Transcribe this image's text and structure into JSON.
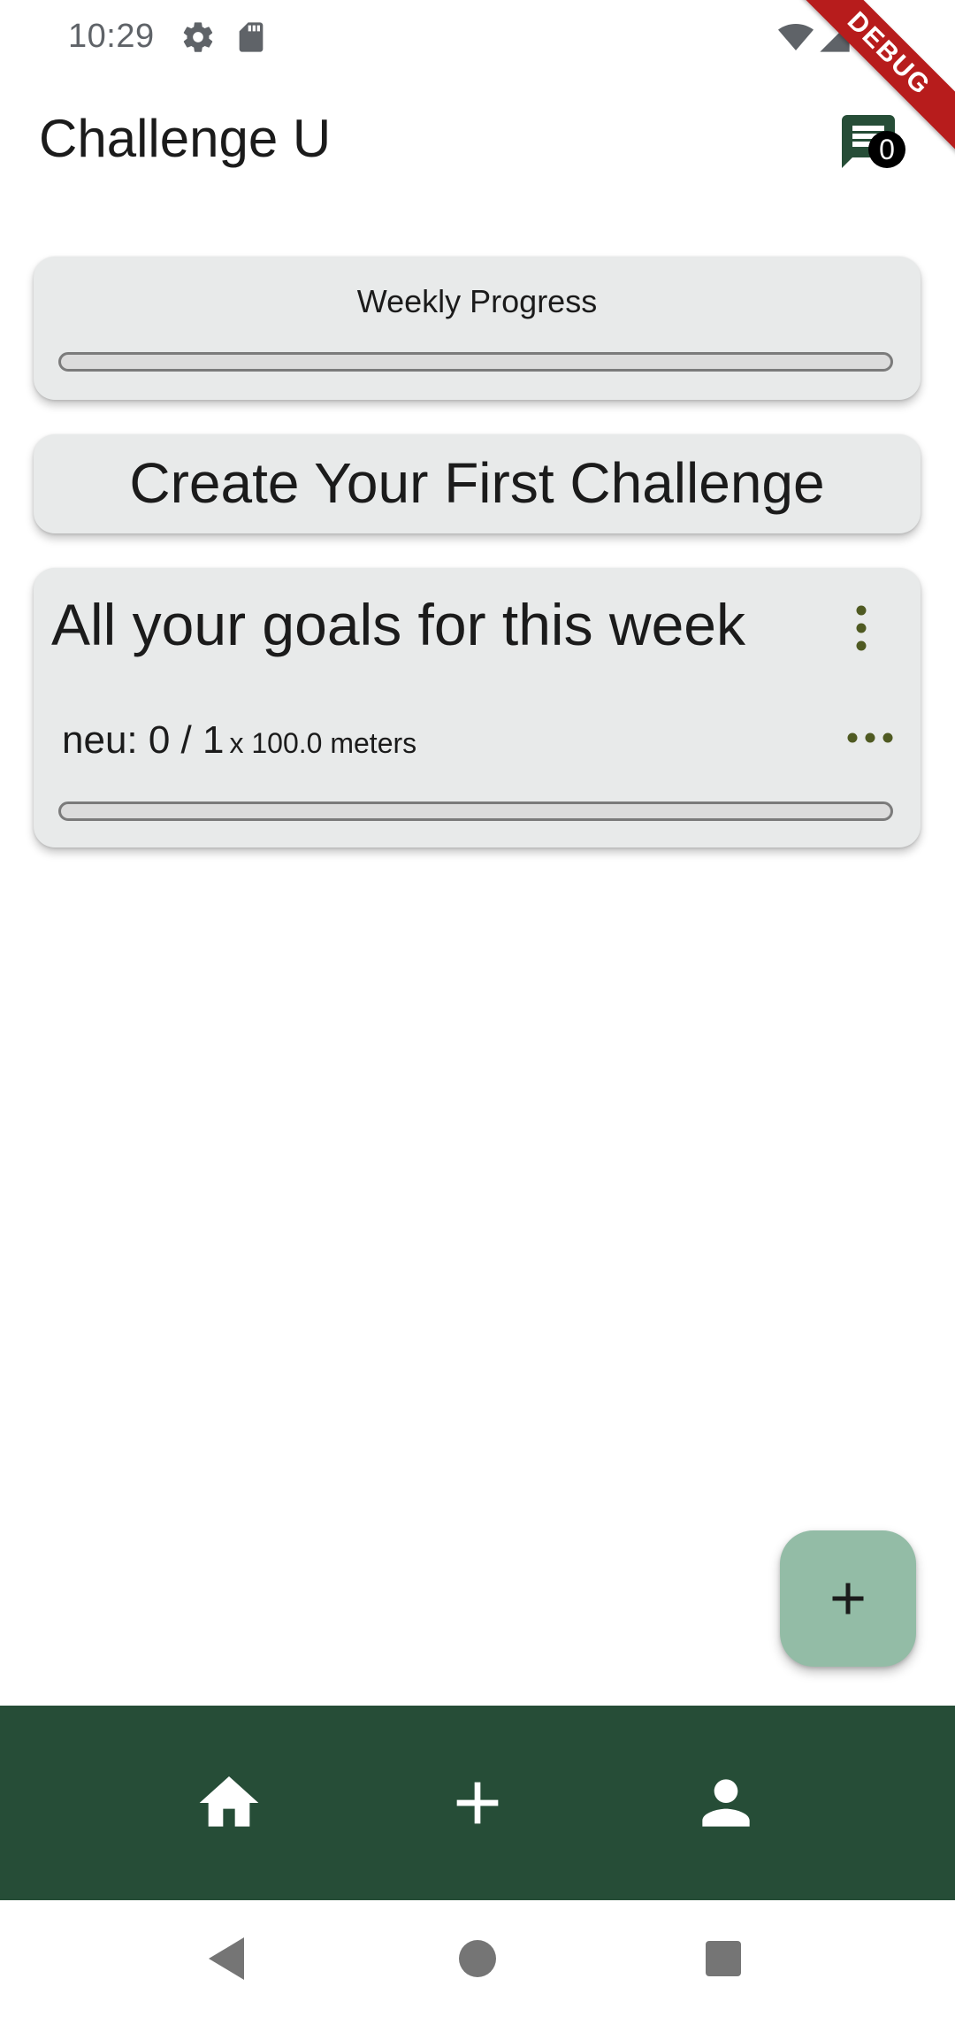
{
  "status_bar": {
    "time": "10:29",
    "icons": [
      "settings-icon",
      "sd-card-icon",
      "wifi-icon",
      "cell-signal-icon",
      "battery-icon"
    ]
  },
  "debug_banner": "DEBUG",
  "app_bar": {
    "title": "Challenge U",
    "chat_badge_count": "0",
    "chat_icon": "chat-icon"
  },
  "weekly_progress": {
    "title": "Weekly Progress",
    "progress": 0
  },
  "create_challenge": {
    "label": "Create Your First Challenge"
  },
  "goals_card": {
    "title": "All your goals for this week",
    "menu_icon": "more-vert-icon",
    "goals": [
      {
        "text": "neu: 0 / 1",
        "unit": "x 100.0 meters",
        "menu_icon": "more-horiz-icon",
        "progress": 0
      }
    ]
  },
  "fab": {
    "icon": "add-icon"
  },
  "bottom_nav": {
    "items": [
      {
        "icon": "home-icon"
      },
      {
        "icon": "add-icon"
      },
      {
        "icon": "person-icon"
      }
    ]
  },
  "system_nav": {
    "items": [
      "back-icon",
      "home-circle-icon",
      "recents-icon"
    ]
  },
  "colors": {
    "primary": "#264d37",
    "fab": "#93bca6",
    "card": "#e8eaea",
    "menu_dots": "#4f5a22"
  }
}
